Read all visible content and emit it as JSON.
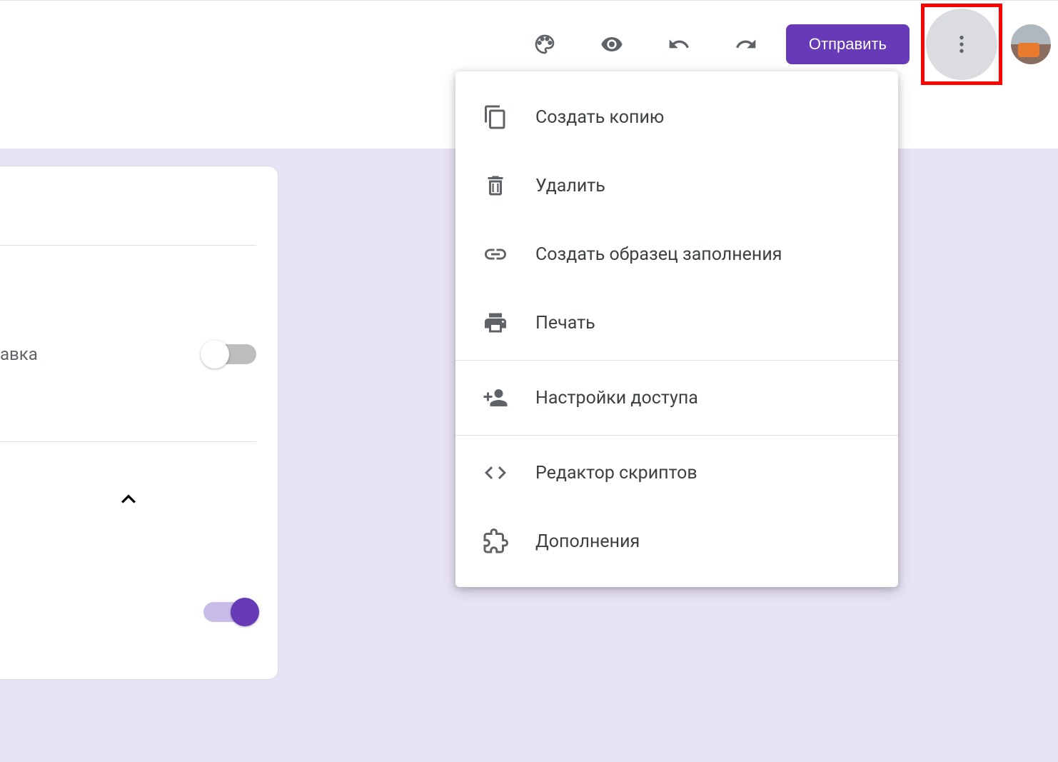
{
  "toolbar": {
    "send_label": "Отправить"
  },
  "card": {
    "row_label": "авка"
  },
  "menu": {
    "items": [
      {
        "icon": "copy",
        "label": "Создать копию"
      },
      {
        "icon": "trash",
        "label": "Удалить"
      },
      {
        "icon": "link",
        "label": "Создать образец заполнения"
      },
      {
        "icon": "print",
        "label": "Печать"
      }
    ],
    "items2": [
      {
        "icon": "share",
        "label": "Настройки доступа"
      }
    ],
    "items3": [
      {
        "icon": "code",
        "label": "Редактор скриптов"
      },
      {
        "icon": "addon",
        "label": "Дополнения"
      }
    ]
  },
  "colors": {
    "accent": "#673ab7",
    "background_tint": "#e8e3f5",
    "highlight_border": "#ff0000"
  }
}
